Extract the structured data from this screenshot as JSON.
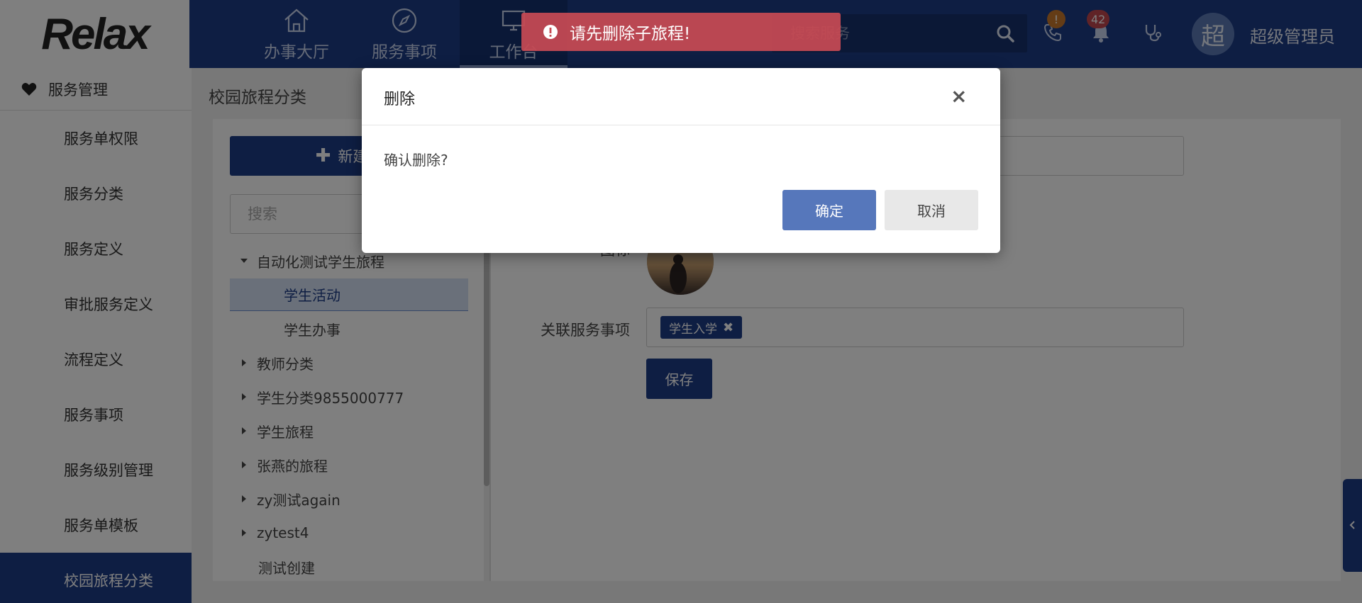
{
  "header": {
    "logo": "Relax",
    "nav": [
      {
        "label": "办事大厅",
        "icon": "home-icon"
      },
      {
        "label": "服务事项",
        "icon": "compass-icon"
      },
      {
        "label": "工作台",
        "icon": "monitor-icon",
        "active": true
      }
    ],
    "search_placeholder": "搜索服务",
    "phone_badge": "!",
    "notification_count": "42",
    "avatar_text": "超",
    "user_name": "超级管理员"
  },
  "sidebar": {
    "group_label": "服务管理",
    "items": [
      {
        "label": "服务单权限"
      },
      {
        "label": "服务分类"
      },
      {
        "label": "服务定义"
      },
      {
        "label": "审批服务定义"
      },
      {
        "label": "流程定义"
      },
      {
        "label": "服务事项"
      },
      {
        "label": "服务级别管理"
      },
      {
        "label": "服务单模板"
      },
      {
        "label": "校园旅程分类",
        "active": true
      }
    ]
  },
  "page": {
    "title": "校园旅程分类",
    "new_button_label": "新建角",
    "tree_search_placeholder": "搜索",
    "tree": [
      {
        "label": "自动化测试学生旅程"
      },
      {
        "label": "学生活动"
      },
      {
        "label": "学生办事"
      },
      {
        "label": "教师分类"
      },
      {
        "label": "学生分类9855000777"
      },
      {
        "label": "学生旅程"
      },
      {
        "label": "张燕的旅程"
      },
      {
        "label": "zy测试again"
      },
      {
        "label": "zytest4"
      },
      {
        "label": "测试创建"
      }
    ],
    "icon_label": "图标",
    "related_label": "关联服务事项",
    "tag_label": "学生入学",
    "tag_close": "✖",
    "save_label": "保存"
  },
  "modal": {
    "title": "删除",
    "close": "×",
    "message": "确认删除?",
    "ok_label": "确定",
    "cancel_label": "取消"
  },
  "toast": {
    "message": "请先删除子旅程!",
    "color": "#c74a54"
  },
  "colors": {
    "primary": "#1d3c87",
    "overlay": "rgba(0,0,0,0.5)"
  }
}
